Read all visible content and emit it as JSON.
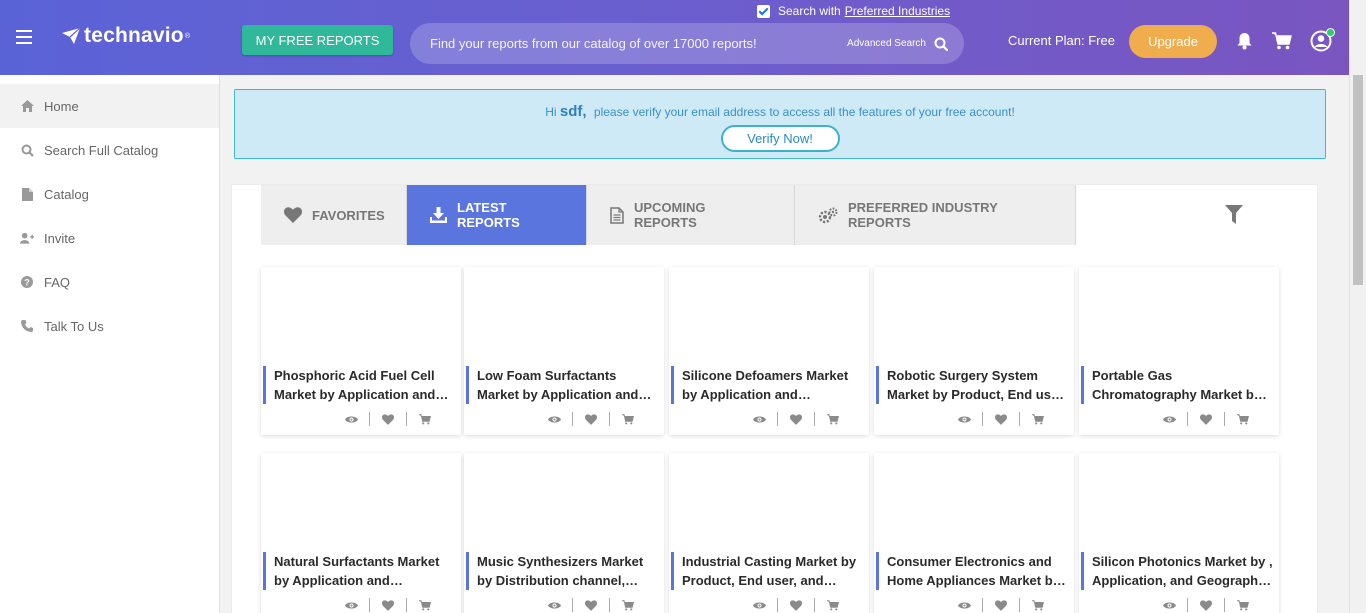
{
  "header": {
    "logo_text": "technavio",
    "logo_tm": "®",
    "free_reports_label": "MY FREE REPORTS",
    "search_placeholder": "Find your reports from our catalog of over 17000 reports!",
    "advanced_search_label": "Advanced Search",
    "preferred_prefix": "Search with",
    "preferred_link": "Preferred Industries",
    "preferred_checked": true,
    "plan_text": "Current Plan: Free",
    "upgrade_label": "Upgrade"
  },
  "sidebar": {
    "items": [
      {
        "label": "Home",
        "icon": "home-icon"
      },
      {
        "label": "Search Full Catalog",
        "icon": "search-icon"
      },
      {
        "label": "Catalog",
        "icon": "file-icon"
      },
      {
        "label": "Invite",
        "icon": "user-plus-icon"
      },
      {
        "label": "FAQ",
        "icon": "question-icon"
      },
      {
        "label": "Talk To Us",
        "icon": "phone-icon"
      }
    ]
  },
  "verify": {
    "hi": "Hi",
    "name": "sdf,",
    "message": "please verify your email address to access all the features of your free account!",
    "button": "Verify Now!"
  },
  "tabs": [
    {
      "label": "FAVORITES",
      "icon": "heart-icon"
    },
    {
      "label": "LATEST REPORTS",
      "icon": "download-icon"
    },
    {
      "label": "UPCOMING REPORTS",
      "icon": "document-icon"
    },
    {
      "label": "PREFERRED INDUSTRY REPORTS",
      "icon": "gears-icon"
    }
  ],
  "cards": [
    {
      "title": "Phosphoric Acid Fuel Cell Market by Application and Geography - Forecast and Analysis"
    },
    {
      "title": "Low Foam Surfactants Market by Application and Geography - Forecast and Analysis"
    },
    {
      "title": "Silicone Defoamers Market by Application and Geography - Forecast and Analysis"
    },
    {
      "title": "Robotic Surgery System Market by Product, End user, and Geography - Forecast and Analysis"
    },
    {
      "title": "Portable Gas Chromatography Market by End-user and Geography - Forecast and Analysis"
    },
    {
      "title": "Natural Surfactants Market by Application and Geography - Forecast and Analysis"
    },
    {
      "title": "Music Synthesizers Market by Distribution channel, Type, and Geography - Forecast and Analysis"
    },
    {
      "title": "Industrial Casting Market by Product, End user, and Geography - Forecast and Analysis"
    },
    {
      "title": "Consumer Electronics and Home Appliances Market by Product and Geography - Forecast and Analysis"
    },
    {
      "title": "Silicon Photonics Market by , Application, and Geography - Forecast and Analysis"
    }
  ],
  "colors": {
    "accent": "#5b75de",
    "green_button": "#2fb89a",
    "upgrade": "#f0ad4e",
    "verify_bg": "#cfeaf7"
  }
}
